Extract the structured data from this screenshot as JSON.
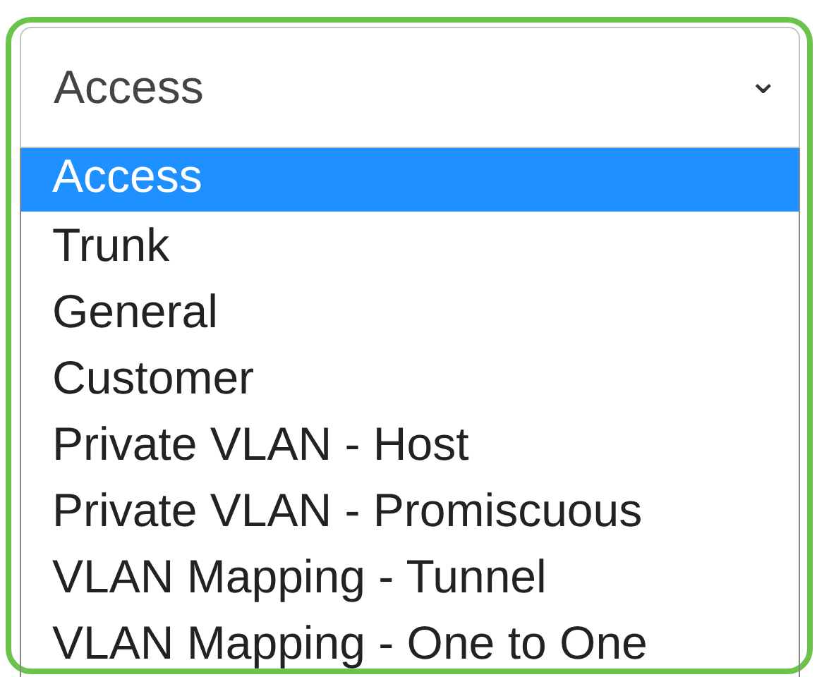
{
  "select": {
    "value": "Access",
    "caret": "⌄"
  },
  "options": [
    {
      "label": "Access",
      "selected": true
    },
    {
      "label": "Trunk",
      "selected": false
    },
    {
      "label": "General",
      "selected": false
    },
    {
      "label": "Customer",
      "selected": false
    },
    {
      "label": "Private VLAN - Host",
      "selected": false
    },
    {
      "label": "Private VLAN - Promiscuous",
      "selected": false
    },
    {
      "label": "VLAN Mapping - Tunnel",
      "selected": false
    },
    {
      "label": "VLAN Mapping - One to One",
      "selected": false
    }
  ]
}
